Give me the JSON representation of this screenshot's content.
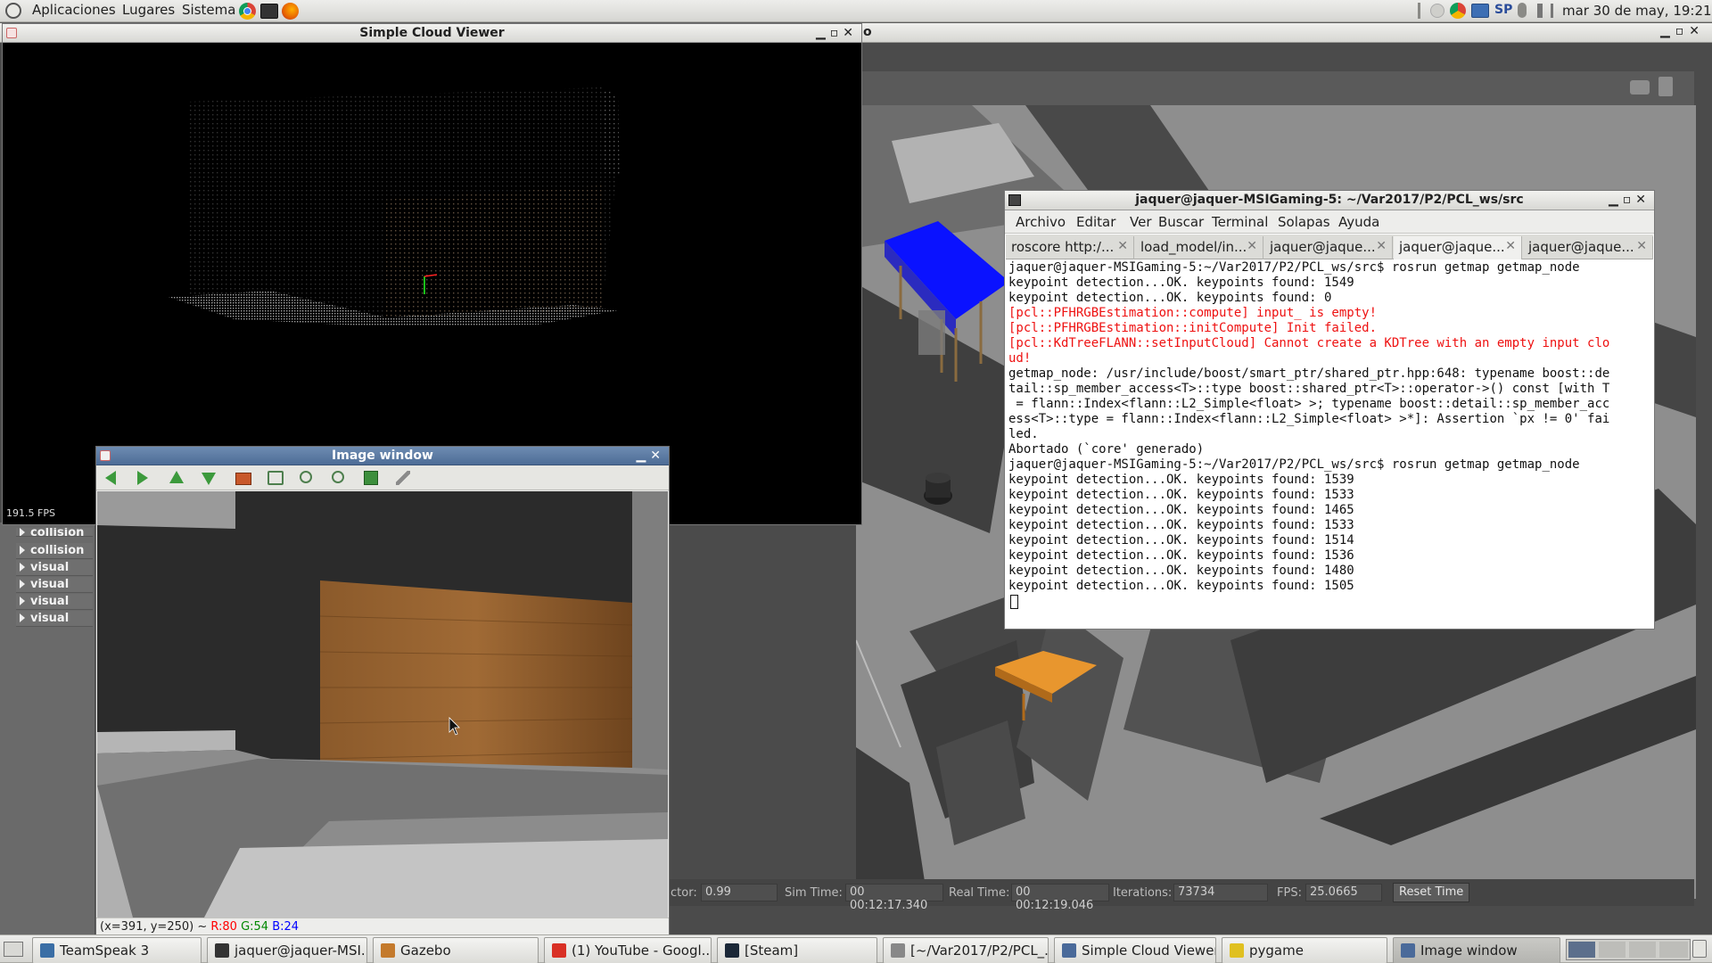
{
  "top_panel": {
    "menu": [
      "Aplicaciones",
      "Lugares",
      "Sistema"
    ],
    "keyboard_layout": "SP",
    "clock": "mar 30 de may, 19:21"
  },
  "gazebo": {
    "title_fragment": "o",
    "tree_items": [
      "collision",
      "collision",
      "visual",
      "visual",
      "visual",
      "visual"
    ],
    "stats": {
      "factor_label": "ctor:",
      "factor_value": "0.99",
      "sim_time_label": "Sim Time:",
      "sim_time_value": "00 00:12:17.340",
      "real_time_label": "Real Time:",
      "real_time_value": "00 00:12:19.046",
      "iterations_label": "Iterations:",
      "iterations_value": "73734",
      "fps_label": "FPS:",
      "fps_value": "25.0665",
      "reset_label": "Reset Time"
    }
  },
  "cloud_viewer": {
    "title": "Simple Cloud Viewer",
    "fps": "191.5 FPS"
  },
  "image_window": {
    "title": "Image window",
    "status_coords": "(x=391, y=250) ~",
    "status_r": "R:80",
    "status_g": "G:54",
    "status_b": "B:24",
    "toolbar_icons": [
      "arrow-left-icon",
      "arrow-right-icon",
      "arrow-up-icon",
      "arrow-down-icon",
      "image-icon",
      "zoom-fit-icon",
      "zoom-in-icon",
      "zoom-out-icon",
      "save-icon",
      "properties-icon"
    ]
  },
  "terminal": {
    "title": "jaquer@jaquer-MSIGaming-5: ~/Var2017/P2/PCL_ws/src",
    "menu": [
      "Archivo",
      "Editar",
      "Ver",
      "Buscar",
      "Terminal",
      "Solapas",
      "Ayuda"
    ],
    "tabs": [
      "roscore http:/...",
      "load_model/in...",
      "jaquer@jaque...",
      "jaquer@jaque...",
      "jaquer@jaque..."
    ],
    "active_tab": 3,
    "lines": [
      {
        "t": "jaquer@jaquer-MSIGaming-5:~/Var2017/P2/PCL_ws/src$ rosrun getmap getmap_node",
        "c": "normal"
      },
      {
        "t": "keypoint detection...OK. keypoints found: 1549",
        "c": "normal"
      },
      {
        "t": "keypoint detection...OK. keypoints found: 0",
        "c": "normal"
      },
      {
        "t": "[pcl::PFHRGBEstimation::compute] input_ is empty!",
        "c": "red"
      },
      {
        "t": "[pcl::PFHRGBEstimation::initCompute] Init failed.",
        "c": "red"
      },
      {
        "t": "[pcl::KdTreeFLANN::setInputCloud] Cannot create a KDTree with an empty input clo",
        "c": "red"
      },
      {
        "t": "ud!",
        "c": "red"
      },
      {
        "t": "getmap_node: /usr/include/boost/smart_ptr/shared_ptr.hpp:648: typename boost::de",
        "c": "normal"
      },
      {
        "t": "tail::sp_member_access<T>::type boost::shared_ptr<T>::operator->() const [with T",
        "c": "normal"
      },
      {
        "t": " = flann::Index<flann::L2_Simple<float> >; typename boost::detail::sp_member_acc",
        "c": "normal"
      },
      {
        "t": "ess<T>::type = flann::Index<flann::L2_Simple<float> >*]: Assertion `px != 0' fai",
        "c": "normal"
      },
      {
        "t": "led.",
        "c": "normal"
      },
      {
        "t": "Abortado (`core' generado)",
        "c": "normal"
      },
      {
        "t": "jaquer@jaquer-MSIGaming-5:~/Var2017/P2/PCL_ws/src$ rosrun getmap getmap_node",
        "c": "normal"
      },
      {
        "t": "keypoint detection...OK. keypoints found: 1539",
        "c": "normal"
      },
      {
        "t": "keypoint detection...OK. keypoints found: 1533",
        "c": "normal"
      },
      {
        "t": "keypoint detection...OK. keypoints found: 1465",
        "c": "normal"
      },
      {
        "t": "keypoint detection...OK. keypoints found: 1533",
        "c": "normal"
      },
      {
        "t": "keypoint detection...OK. keypoints found: 1514",
        "c": "normal"
      },
      {
        "t": "keypoint detection...OK. keypoints found: 1536",
        "c": "normal"
      },
      {
        "t": "keypoint detection...OK. keypoints found: 1480",
        "c": "normal"
      },
      {
        "t": "keypoint detection...OK. keypoints found: 1505",
        "c": "normal"
      }
    ]
  },
  "taskbar": [
    {
      "label": "TeamSpeak 3",
      "icon": "teamspeak-icon",
      "color": "#3a6ea5"
    },
    {
      "label": "jaquer@jaquer-MSI...",
      "icon": "terminal-icon",
      "color": "#333333"
    },
    {
      "label": "Gazebo",
      "icon": "gazebo-icon",
      "color": "#c47a2c"
    },
    {
      "label": "(1) YouTube - Googl...",
      "icon": "chrome-icon",
      "color": "#d93025"
    },
    {
      "label": "[Steam]",
      "icon": "steam-icon",
      "color": "#1b2838"
    },
    {
      "label": "[~/Var2017/P2/PCL_...",
      "icon": "file-manager-icon",
      "color": "#888888"
    },
    {
      "label": "Simple Cloud Viewer",
      "icon": "window-icon",
      "color": "#4a6a9a"
    },
    {
      "label": "pygame",
      "icon": "pygame-icon",
      "color": "#e0c020"
    },
    {
      "label": "Image window",
      "icon": "window-icon",
      "color": "#4a6a9a"
    }
  ],
  "taskbar_active": 8,
  "colors": {
    "accent_blue": "#0000ff",
    "terminal_red": "#e11111",
    "status_r": "#ff0000",
    "status_g": "#008800",
    "status_b": "#0000ff"
  }
}
